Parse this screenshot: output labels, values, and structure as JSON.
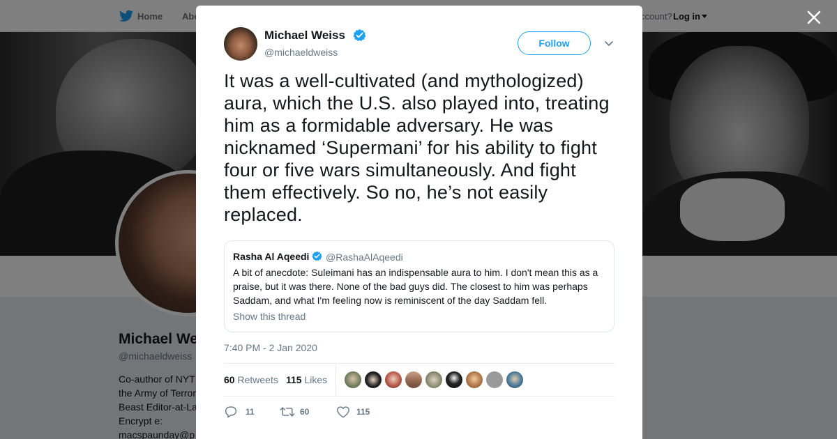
{
  "nav": {
    "home_label": "Home",
    "about_label": "Abo",
    "account_prompt": "ccount?",
    "login_label": "Log in"
  },
  "profile": {
    "name": "Michael We",
    "handle": "@michaeldweiss",
    "bio_lines": [
      "Co-author of NYT",
      "the Army of Terror",
      "Beast Editor-at-La",
      "Encrypt e:",
      "macspaunday@p"
    ]
  },
  "tweet": {
    "author_name": "Michael Weiss",
    "author_handle": "@michaeldweiss",
    "follow_label": "Follow",
    "text": "It was a well-cultivated (and mythologized) aura, which the U.S. also played into, treating him as a formidable adversary. He was nicknamed ‘Supermani’ for his ability to fight four or five wars simultaneously. And fight them effectively. So no, he’s not easily replaced.",
    "quoted": {
      "name": "Rasha Al Aqeedi",
      "handle": "@RashaAlAqeedi",
      "text": "A bit of anecdote: Suleimani has an indispensable aura to him. I don't mean this as a praise, but it was there. None of the bad guys did. The closest to him was perhaps Saddam, and what I'm feeling now is reminiscent of the day Saddam fell.",
      "thread_label": "Show this thread"
    },
    "timestamp": "7:40 PM - 2 Jan 2020",
    "retweets_count": "60",
    "retweets_label": "Retweets",
    "likes_count": "115",
    "likes_label": "Likes",
    "actions": {
      "reply_count": "11",
      "retweet_count": "60",
      "like_count": "115"
    }
  },
  "colors": {
    "accent": "#1da1f2",
    "secondary_text": "#657786",
    "overlay": "rgba(0,0,0,0.5)"
  },
  "icons": [
    "twitter-bird-icon",
    "close-icon",
    "verified-badge-icon",
    "chevron-down-icon",
    "reply-icon",
    "retweet-icon",
    "like-heart-icon"
  ]
}
